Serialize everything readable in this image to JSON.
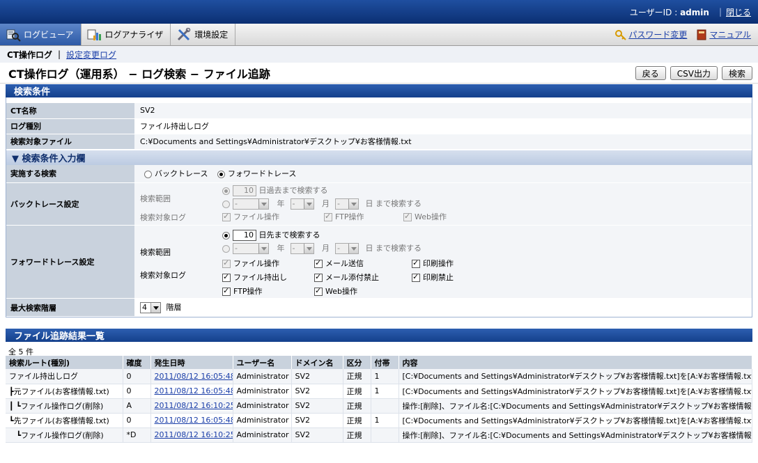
{
  "header": {
    "user_label": "ユーザーID : ",
    "user_id": "admin",
    "close": "閉じる"
  },
  "tabs": [
    {
      "label": "ログビューア",
      "icon": "log-viewer-icon",
      "active": true
    },
    {
      "label": "ログアナライザ",
      "icon": "log-analyzer-icon",
      "active": false
    },
    {
      "label": "環境設定",
      "icon": "settings-tools-icon",
      "active": false
    }
  ],
  "links": {
    "password": "パスワード変更",
    "manual": "マニュアル"
  },
  "subnav": {
    "current": "CT操作ログ",
    "other": "設定変更ログ"
  },
  "page": {
    "title": "CT操作ログ（運用系） − ログ検索 − ファイル追跡",
    "back": "戻る",
    "csv": "CSV出力",
    "search": "検索"
  },
  "search_conditions": {
    "header": "検索条件",
    "rows": [
      {
        "label": "CT名称",
        "value": "SV2"
      },
      {
        "label": "ログ種別",
        "value": "ファイル持出しログ"
      },
      {
        "label": "検索対象ファイル",
        "value": "C:¥Documents and Settings¥Administrator¥デスクトップ¥お客様情報.txt"
      }
    ]
  },
  "input": {
    "header": "▼ 検索条件入力欄",
    "exec_label": "実施する検索",
    "backtrace_option": "バックトレース",
    "forward_option": "フォワードトレース",
    "selected": "forward",
    "backtrace": {
      "label": "バックトレース設定",
      "range_label": "検索範囲",
      "days_value": "10",
      "days_suffix": "日過去まで検索する",
      "year": "年",
      "month": "月",
      "day_suffix": "日  まで検索する",
      "date_placeholder": "-",
      "log_label": "検索対象ログ",
      "file_op": "ファイル操作",
      "ftp_op": "FTP操作",
      "web_op": "Web操作"
    },
    "forward": {
      "label": "フォワードトレース設定",
      "range_label": "検索範囲",
      "days_value": "10",
      "days_suffix": "日先まで検索する",
      "year": "年",
      "month": "月",
      "day_suffix": "日  まで検索する",
      "date_placeholder": "-",
      "log_label": "検索対象ログ",
      "file_op": "ファイル操作",
      "mail_send": "メール送信",
      "print_op": "印刷操作",
      "file_out": "ファイル持出し",
      "mail_attach": "メール添付禁止",
      "print_ban": "印刷禁止",
      "ftp_op": "FTP操作",
      "web_op": "Web操作"
    },
    "max_level_label": "最大検索階層",
    "max_level_value": "4",
    "max_level_suffix": "階層"
  },
  "results": {
    "header": "ファイル追跡結果一覧",
    "count": "全 5 件",
    "columns": [
      "検索ルート(種別)",
      "確度",
      "発生日時",
      "ユーザー名",
      "ドメイン名",
      "区分",
      "付帯",
      "内容"
    ],
    "rows": [
      [
        "ファイル持出しログ",
        "0",
        "2011/08/12 16:05:48",
        "Administrator",
        "SV2",
        "正規",
        "1",
        "[C:¥Documents and Settings¥Administrator¥デスクトップ¥お客様情報.txt]を[A:¥お客様情報.txt]とし"
      ],
      [
        "┣元ファイル(お客様情報.txt)",
        "0",
        "2011/08/12 16:05:48",
        "Administrator",
        "SV2",
        "正規",
        "1",
        "[C:¥Documents and Settings¥Administrator¥デスクトップ¥お客様情報.txt]を[A:¥お客様情報.txt]とし"
      ],
      [
        "┃ ┗ファイル操作ログ(削除)",
        "A",
        "2011/08/12 16:10:25",
        "Administrator",
        "SV2",
        "正規",
        "",
        "操作:[削除]、ファイル名:[C:¥Documents and Settings¥Administrator¥デスクトップ¥お客様情報.t"
      ],
      [
        "┗先ファイル(お客様情報.txt)",
        "0",
        "2011/08/12 16:05:48",
        "Administrator",
        "SV2",
        "正規",
        "1",
        "[C:¥Documents and Settings¥Administrator¥デスクトップ¥お客様情報.txt]を[A:¥お客様情報.txt]とし"
      ],
      [
        "   ┗ファイル操作ログ(削除)",
        "*D",
        "2011/08/12 16:10:25",
        "Administrator",
        "SV2",
        "正規",
        "",
        "操作:[削除]、ファイル名:[C:¥Documents and Settings¥Administrator¥デスクトップ¥お客様情報.t"
      ]
    ]
  }
}
